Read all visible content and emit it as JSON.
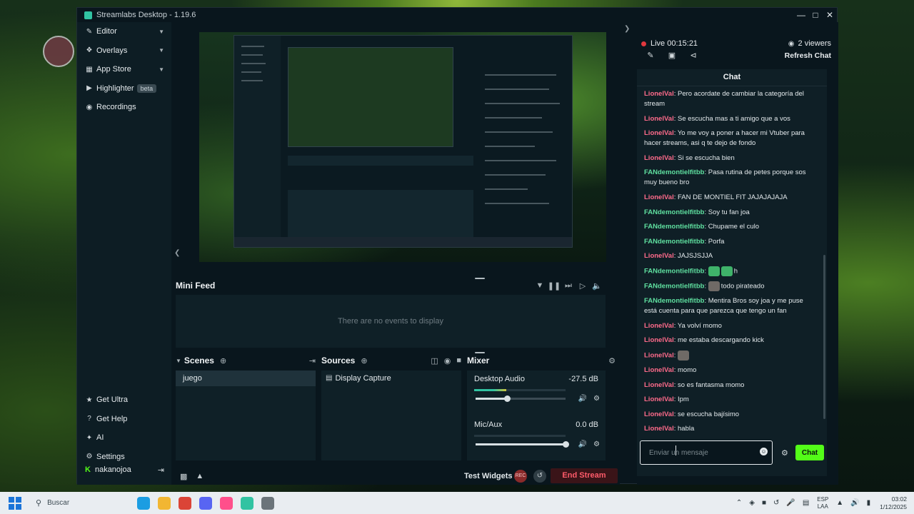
{
  "window": {
    "title": "Streamlabs Desktop - 1.19.6"
  },
  "sidebar": {
    "items": [
      {
        "label": "Editor",
        "icon": "editor-icon",
        "expandable": true
      },
      {
        "label": "Overlays",
        "icon": "overlays-icon",
        "expandable": true
      },
      {
        "label": "App Store",
        "icon": "app-store-icon",
        "expandable": true
      },
      {
        "label": "Highlighter",
        "icon": "highlighter-icon",
        "badge": "beta"
      },
      {
        "label": "Recordings",
        "icon": "recordings-icon"
      }
    ],
    "bottom_items": [
      {
        "label": "Get Ultra",
        "icon": "ultra-icon"
      },
      {
        "label": "Get Help",
        "icon": "help-icon"
      },
      {
        "label": "AI",
        "icon": "ai-icon"
      },
      {
        "label": "Settings",
        "icon": "gear-icon"
      }
    ],
    "user": "nakanojoa"
  },
  "minifeed": {
    "title": "Mini Feed",
    "empty": "There are no events to display"
  },
  "scenes": {
    "title": "Scenes",
    "items": [
      "juego"
    ]
  },
  "sources": {
    "title": "Sources",
    "items": [
      "Display Capture"
    ]
  },
  "mixer": {
    "title": "Mixer",
    "channels": [
      {
        "name": "Desktop Audio",
        "db": "-27.5 dB",
        "level": 0.35,
        "volume": 0.35
      },
      {
        "name": "Mic/Aux",
        "db": "0.0 dB",
        "level": 0.0,
        "volume": 1.0
      }
    ]
  },
  "footer": {
    "test_widgets": "Test Widgets",
    "rec": "REC",
    "end_stream": "End Stream"
  },
  "live": {
    "status": "Live 00:15:21",
    "viewers": "2 viewers",
    "refresh": "Refresh Chat"
  },
  "chat": {
    "title": "Chat",
    "placeholder": "Enviar un mensaje",
    "send": "Chat",
    "messages": [
      {
        "user": "LionelVal",
        "text": "Pero acordate de cambiar la categoría del stream"
      },
      {
        "user": "LionelVal",
        "text": "Se escucha mas a ti amigo que a vos"
      },
      {
        "user": "LionelVal",
        "text": "Yo me voy a poner a hacer mi Vtuber para hacer streams, asi q te dejo de fondo"
      },
      {
        "user": "LionelVal",
        "text": "Si se escucha bien"
      },
      {
        "user": "FANdemontielfitbb",
        "text": "Pasa rutina de petes porque sos muy bueno bro"
      },
      {
        "user": "LionelVal",
        "text": "FAN DE MONTIEL FIT JAJAJAJAJA"
      },
      {
        "user": "FANdemontielfitbb",
        "text": "Soy tu fan joa"
      },
      {
        "user": "FANdemontielfitbb",
        "text": "Chupame el culo"
      },
      {
        "user": "FANdemontielfitbb",
        "text": "Porfa"
      },
      {
        "user": "LionelVal",
        "text": "JAJSJSJJA"
      },
      {
        "user": "FANdemontielfitbb",
        "text": "h",
        "emotes": [
          "green",
          "green"
        ]
      },
      {
        "user": "FANdemontielfitbb",
        "text": "todo pirateado",
        "emotes": [
          "grey"
        ]
      },
      {
        "user": "FANdemontielfitbb",
        "text": "Mentira Bros soy joa y me puse está cuenta para que parezca que tengo un fan"
      },
      {
        "user": "LionelVal",
        "text": "Ya volví momo"
      },
      {
        "user": "LionelVal",
        "text": "me estaba descargando kick"
      },
      {
        "user": "LionelVal",
        "text": "",
        "emotes": [
          "grey"
        ]
      },
      {
        "user": "LionelVal",
        "text": "momo"
      },
      {
        "user": "LionelVal",
        "text": "so es fantasma momo"
      },
      {
        "user": "LionelVal",
        "text": "Ipm"
      },
      {
        "user": "LionelVal",
        "text": "se escucha bajísimo"
      },
      {
        "user": "LionelVal",
        "text": "habla"
      }
    ]
  },
  "taskbar": {
    "search": "Buscar",
    "apps": [
      {
        "icon": "edge-icon",
        "color": "#1b9de2"
      },
      {
        "icon": "folder-icon",
        "color": "#f2b632"
      },
      {
        "icon": "chrome-icon",
        "color": "#db4437"
      },
      {
        "icon": "discord-icon",
        "color": "#5865f2"
      },
      {
        "icon": "app-pink-icon",
        "color": "#ff4f8b"
      },
      {
        "icon": "streamlabs-icon",
        "color": "#31c3a2"
      },
      {
        "icon": "mouse-app-icon",
        "color": "#6b747a"
      }
    ],
    "lang1": "ESP",
    "lang2": "LAA",
    "time": "03:02",
    "date": "1/12/2025"
  }
}
